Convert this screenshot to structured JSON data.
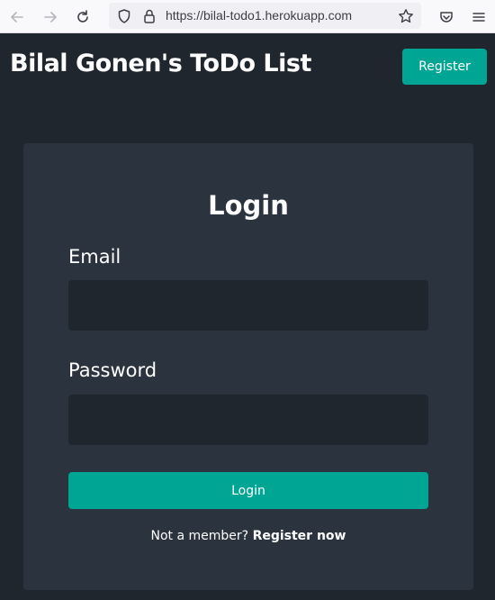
{
  "browser": {
    "url": "https://bilal-todo1.herokuapp.com",
    "icons": [
      "back-icon",
      "forward-icon",
      "reload-icon",
      "shield-icon",
      "lock-icon",
      "star-icon",
      "pocket-icon",
      "menu-icon"
    ]
  },
  "header": {
    "title": "Bilal Gonen's ToDo List",
    "register_label": "Register"
  },
  "login": {
    "title": "Login",
    "email_label": "Email",
    "email_value": "",
    "password_label": "Password",
    "password_value": "",
    "submit_label": "Login",
    "footer_text": "Not a member?",
    "register_link": "Register now"
  },
  "colors": {
    "background": "#1f262e",
    "card": "#2b343e",
    "accent": "#00a594",
    "text": "#ffffff"
  }
}
